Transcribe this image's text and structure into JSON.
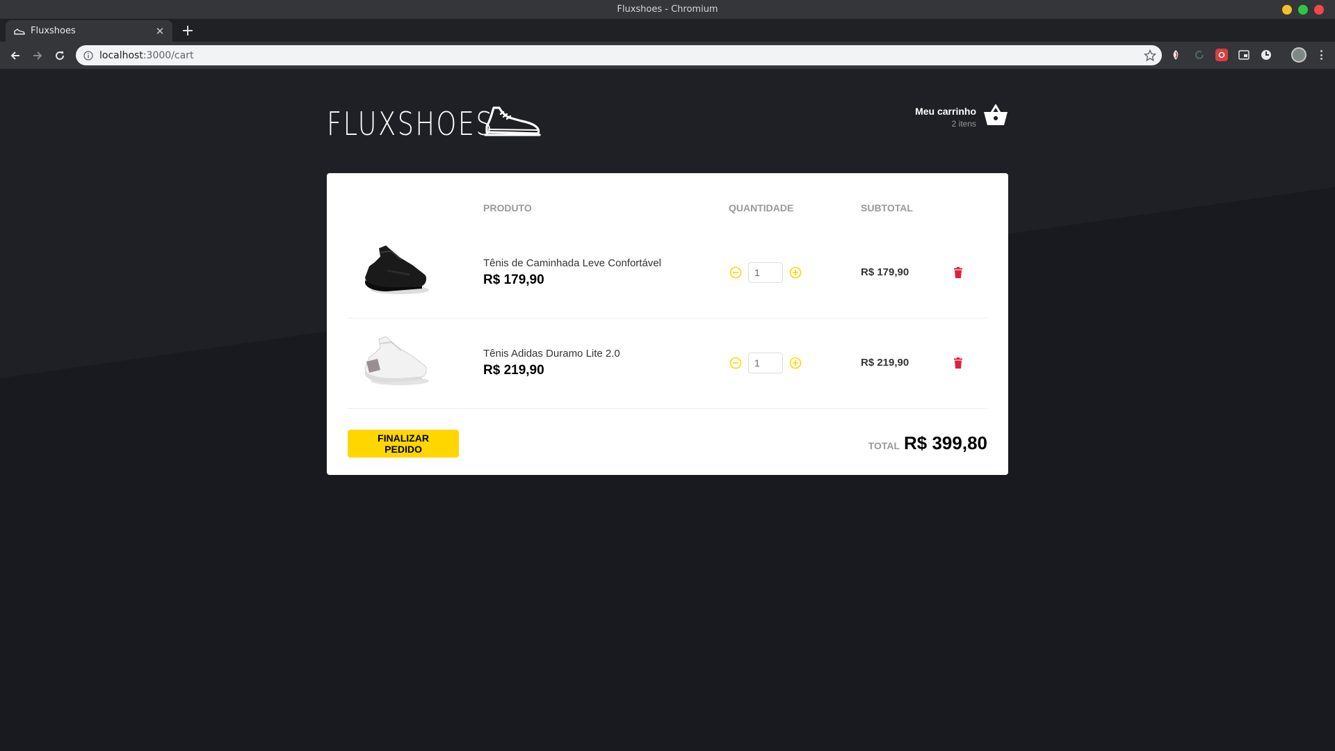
{
  "window": {
    "title": "Fluxshoes - Chromium"
  },
  "browser": {
    "tab": {
      "title": "Fluxshoes",
      "favicon": "shoe-icon"
    },
    "url": {
      "host": "localhost",
      "path": ":3000/cart"
    }
  },
  "header": {
    "logo_text": "FLUXSHOES",
    "cart": {
      "title": "Meu carrinho",
      "count": "2 itens"
    }
  },
  "cart_table": {
    "headers": {
      "product": "PRODUTO",
      "quantity": "QUANTIDADE",
      "subtotal": "SUBTOTAL"
    },
    "items": [
      {
        "title": "Tênis de Caminhada Leve Confortável",
        "price": "R$ 179,90",
        "quantity": "1",
        "subtotal": "R$ 179,90",
        "color": "#1a1a1a"
      },
      {
        "title": "Tênis Adidas Duramo Lite 2.0",
        "price": "R$ 219,90",
        "quantity": "1",
        "subtotal": "R$ 219,90",
        "color": "#f2f2f2"
      }
    ]
  },
  "footer": {
    "checkout_label": "FINALIZAR PEDIDO",
    "total_label": "TOTAL",
    "total_value": "R$ 399,80"
  },
  "colors": {
    "accent": "#ffd600",
    "delete": "#e02041",
    "background": "#191920"
  }
}
